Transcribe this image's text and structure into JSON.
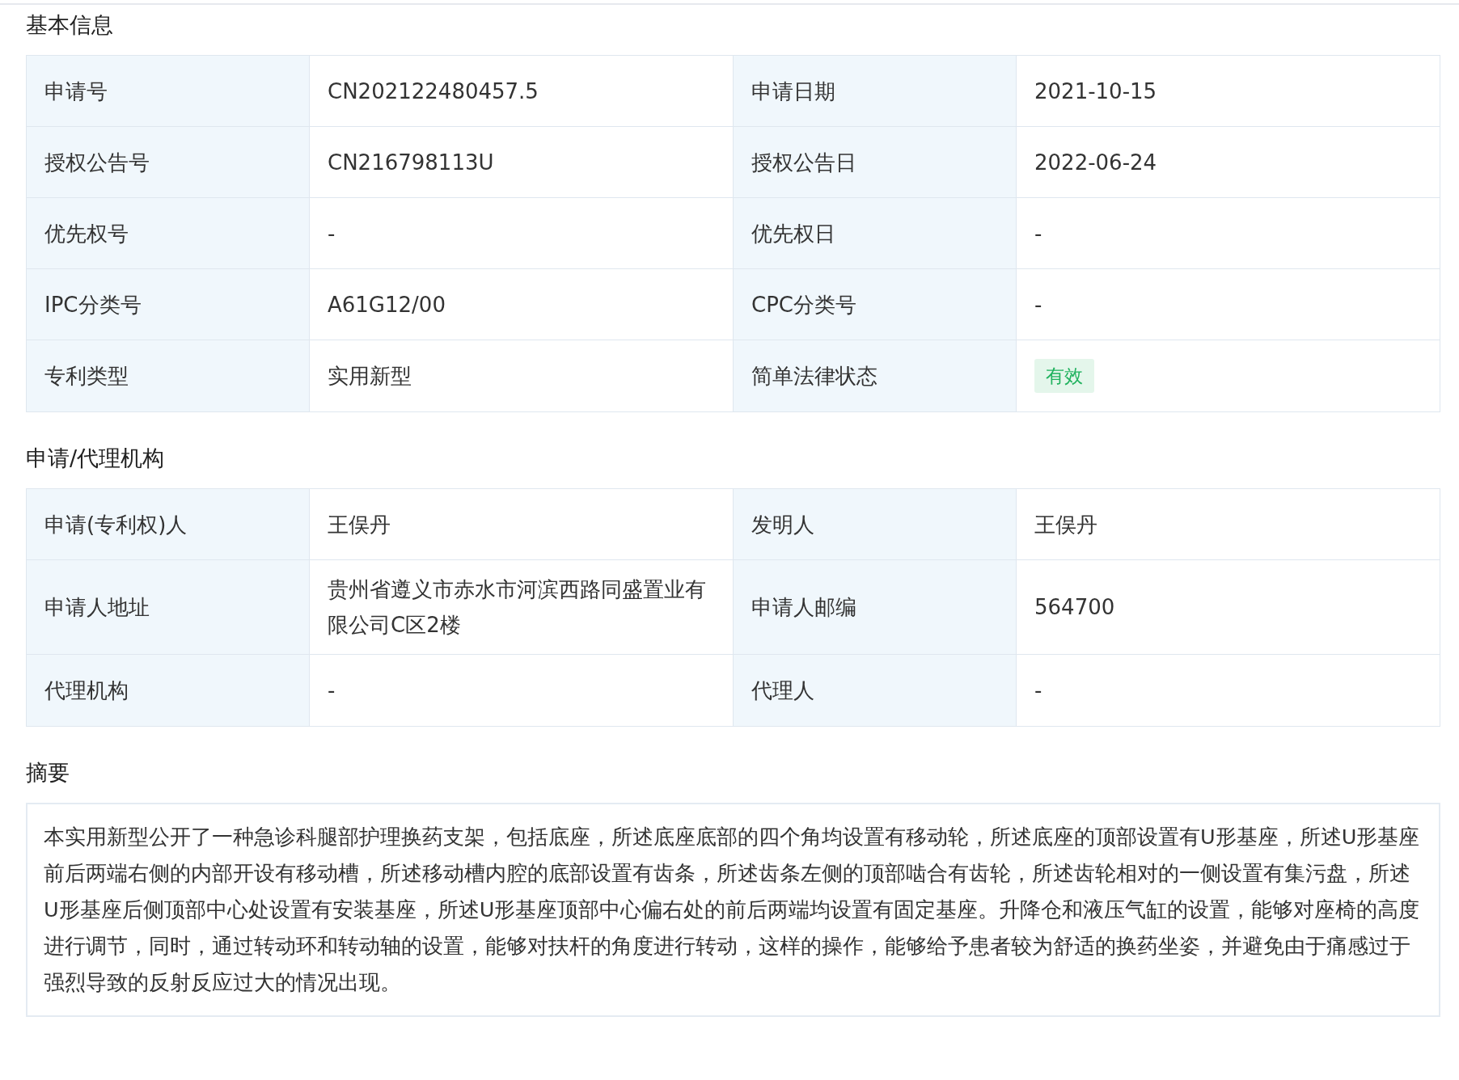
{
  "sections": [
    {
      "title": "基本信息",
      "rows": [
        [
          {
            "label": "申请号",
            "value": "CN202122480457.5",
            "kind": "text"
          },
          {
            "label": "申请日期",
            "value": "2021-10-15",
            "kind": "text"
          }
        ],
        [
          {
            "label": "授权公告号",
            "value": "CN216798113U",
            "kind": "text"
          },
          {
            "label": "授权公告日",
            "value": "2022-06-24",
            "kind": "text"
          }
        ],
        [
          {
            "label": "优先权号",
            "value": "-",
            "kind": "text"
          },
          {
            "label": "优先权日",
            "value": "-",
            "kind": "text"
          }
        ],
        [
          {
            "label": "IPC分类号",
            "value": "A61G12/00",
            "kind": "text"
          },
          {
            "label": "CPC分类号",
            "value": "-",
            "kind": "text"
          }
        ],
        [
          {
            "label": "专利类型",
            "value": "实用新型",
            "kind": "text"
          },
          {
            "label": "简单法律状态",
            "value": "有效",
            "kind": "tag",
            "color": "#20b25e"
          }
        ]
      ]
    },
    {
      "title": "申请/代理机构",
      "rows": [
        [
          {
            "label": "申请(专利权)人",
            "value": "王俣丹",
            "kind": "text"
          },
          {
            "label": "发明人",
            "value": "王俣丹",
            "kind": "text"
          }
        ],
        [
          {
            "label": "申请人地址",
            "value": "贵州省遵义市赤水市河滨西路同盛置业有限公司C区2楼",
            "kind": "text"
          },
          {
            "label": "申请人邮编",
            "value": "564700",
            "kind": "text"
          }
        ],
        [
          {
            "label": "代理机构",
            "value": "-",
            "kind": "text"
          },
          {
            "label": "代理人",
            "value": "-",
            "kind": "text"
          }
        ]
      ]
    }
  ],
  "abstract": {
    "title": "摘要",
    "text": "本实用新型公开了一种急诊科腿部护理换药支架，包括底座，所述底座底部的四个角均设置有移动轮，所述底座的顶部设置有U形基座，所述U形基座前后两端右侧的内部开设有移动槽，所述移动槽内腔的底部设置有齿条，所述齿条左侧的顶部啮合有齿轮，所述齿轮相对的一侧设置有集污盘，所述U形基座后侧顶部中心处设置有安装基座，所述U形基座顶部中心偏右处的前后两端均设置有固定基座。升降仓和液压气缸的设置，能够对座椅的高度进行调节，同时，通过转动环和转动轴的设置，能够对扶杆的角度进行转动，这样的操作，能够给予患者较为舒适的换药坐姿，并避免由于痛感过于强烈导致的反射反应过大的情况出现。"
  }
}
